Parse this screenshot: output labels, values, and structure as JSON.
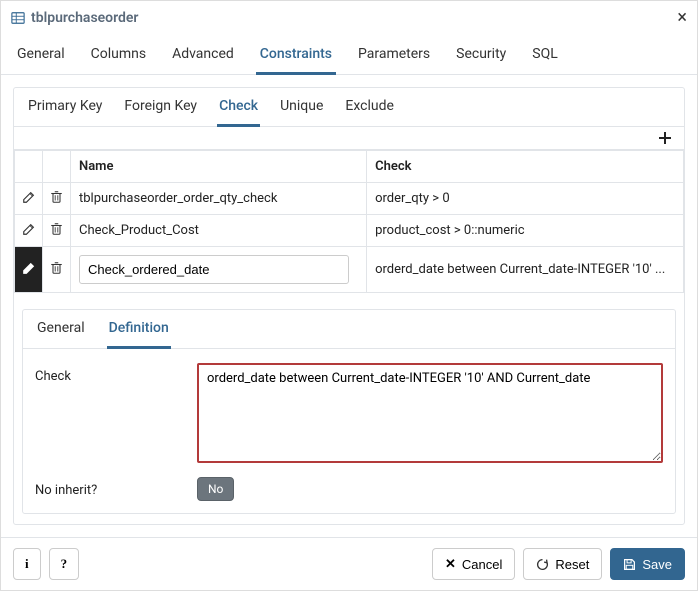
{
  "dialog": {
    "title": "tblpurchaseorder"
  },
  "main_tabs": [
    "General",
    "Columns",
    "Advanced",
    "Constraints",
    "Parameters",
    "Security",
    "SQL"
  ],
  "main_tabs_active_index": 3,
  "constraint_subtabs": [
    "Primary Key",
    "Foreign Key",
    "Check",
    "Unique",
    "Exclude"
  ],
  "constraint_subtabs_active_index": 2,
  "grid": {
    "headers": {
      "name": "Name",
      "check": "Check"
    },
    "rows": [
      {
        "name": "tblpurchaseorder_order_qty_check",
        "check": "order_qty > 0",
        "editing": false
      },
      {
        "name": "Check_Product_Cost",
        "check": "product_cost > 0::numeric",
        "editing": false
      },
      {
        "name": "Check_ordered_date",
        "check": "orderd_date between Current_date-INTEGER '10' ...",
        "editing": true
      }
    ]
  },
  "detail_tabs": [
    "General",
    "Definition"
  ],
  "detail_tabs_active_index": 1,
  "definition_form": {
    "check_label": "Check",
    "check_value": "orderd_date between Current_date-INTEGER '10' AND Current_date",
    "no_inherit_label": "No inherit?",
    "no_inherit_value": "No"
  },
  "footer": {
    "info": "i",
    "help": "?",
    "cancel": "Cancel",
    "reset": "Reset",
    "save": "Save"
  },
  "icons": {
    "table": "table-icon",
    "edit": "pencil-icon",
    "delete": "trash-icon",
    "add": "plus-icon",
    "close_x": "×",
    "cancel_x": "✕",
    "reset_cycle": "♻",
    "save_disk": "save-disk"
  }
}
